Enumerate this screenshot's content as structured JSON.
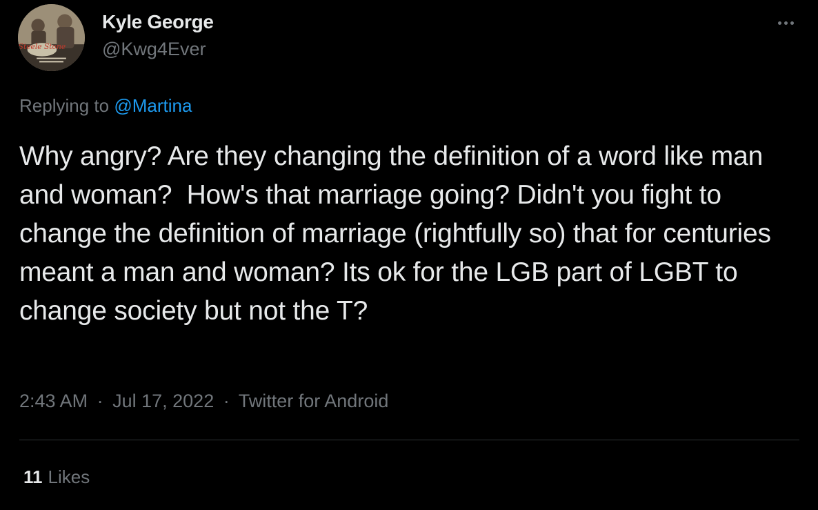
{
  "author": {
    "display_name": "Kyle George",
    "handle": "@Kwg4Ever",
    "avatar_icon": "steele-stone-avatar",
    "avatar_text": "Steele Stone"
  },
  "reply": {
    "prefix": "Replying to",
    "mention": "@Martina"
  },
  "tweet": {
    "text": "Why angry? Are they changing the definition of a word like man and woman?  How's that marriage going? Didn't you fight to change the definition of marriage (rightfully so) that for centuries meant a man and woman? Its ok for the LGB part of LGBT to change society but not the T?"
  },
  "meta": {
    "time": "2:43 AM",
    "separator": "·",
    "date": "Jul 17, 2022",
    "source": "Twitter for Android"
  },
  "stats": {
    "likes_count": "11",
    "likes_label": "Likes"
  },
  "colors": {
    "background": "#000000",
    "primary_text": "#e7e9ea",
    "secondary_text": "#71767b",
    "link": "#1d9bf0",
    "divider": "#2f3336"
  }
}
